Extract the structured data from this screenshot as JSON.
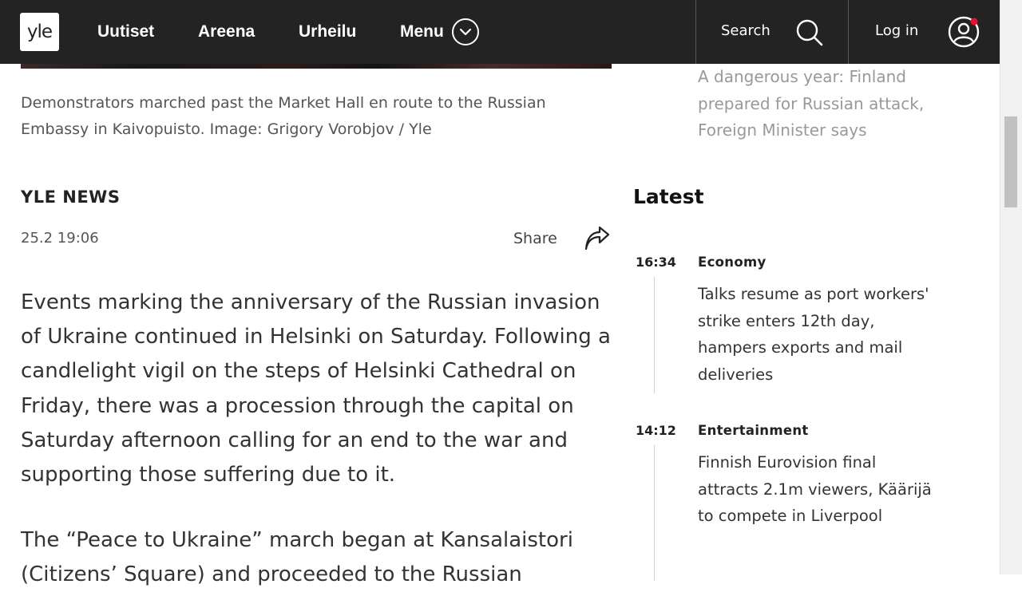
{
  "header": {
    "logo_text": "yle",
    "nav": [
      {
        "label": "Uutiset"
      },
      {
        "label": "Areena"
      },
      {
        "label": "Urheilu"
      },
      {
        "label": "Menu"
      }
    ],
    "search_label": "Search",
    "login_label": "Log in",
    "notification_dot_color": "#e8112d"
  },
  "article": {
    "caption": "Demonstrators marched past the Market Hall en route to the Russian Embassy in Kaivopuisto. Image: Grigory Vorobjov / Yle",
    "source": "YLE NEWS",
    "timestamp": "25.2 19:06",
    "share_label": "Share",
    "paragraphs": [
      "Events marking the anniversary of the Russian invasion of Ukraine continued in Helsinki on Saturday. Following a candlelight vigil on the steps of Helsinki Cathedral on Friday, there was a procession through the capital on Saturday afternoon calling for an end to the war and supporting those suffering due to it.",
      "The “Peace to Ukraine” march began at Kansalaistori (Citizens’ Square) and proceeded to the Russian"
    ]
  },
  "sidebar": {
    "related_link": "A dangerous year: Finland prepared for Russian attack, Foreign Minister says",
    "latest_heading": "Latest",
    "latest": [
      {
        "time": "16:34",
        "category": "Economy",
        "title": "Talks resume as port workers' strike enters 12th day, hampers exports and mail deliveries"
      },
      {
        "time": "14:12",
        "category": "Entertainment",
        "title": "Finnish Eurovision final attracts 2.1m viewers, Käärijä to compete in Liverpool"
      }
    ]
  }
}
